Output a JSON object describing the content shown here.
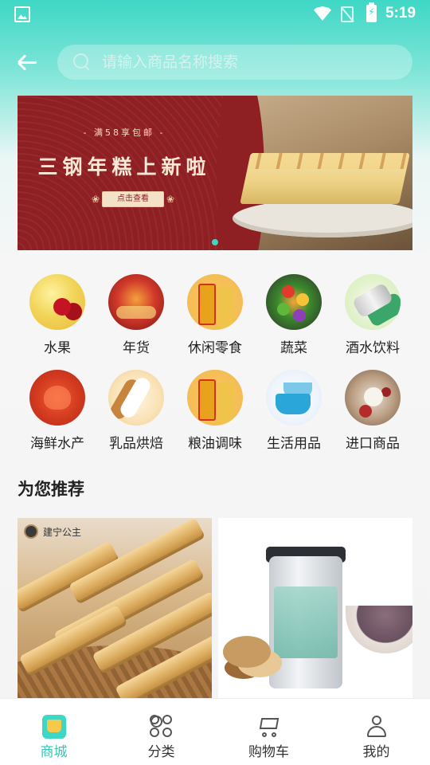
{
  "status_bar": {
    "time": "5:19",
    "icons": [
      "gallery-icon",
      "wifi-icon",
      "no-sim-icon",
      "battery-charging-icon"
    ]
  },
  "header": {
    "back_icon": "arrow-left-icon",
    "search_placeholder": "请输入商品名称搜索",
    "search_icon": "search-icon"
  },
  "banner": {
    "promo": "- 满58享包邮 -",
    "headline": "三钢年糕上新啦",
    "cta": "点击查看",
    "active_dot": 1,
    "accent_color": "#8e1f22"
  },
  "categories": [
    {
      "label": "水果",
      "icon": "fruit-icon"
    },
    {
      "label": "年货",
      "icon": "newyear-goods-icon"
    },
    {
      "label": "休闲零食",
      "icon": "snacks-icon"
    },
    {
      "label": "蔬菜",
      "icon": "vegetables-icon"
    },
    {
      "label": "酒水饮料",
      "icon": "drinks-icon"
    },
    {
      "label": "海鲜水产",
      "icon": "seafood-icon"
    },
    {
      "label": "乳品烘焙",
      "icon": "dairy-bakery-icon"
    },
    {
      "label": "粮油调味",
      "icon": "grain-oil-icon"
    },
    {
      "label": "生活用品",
      "icon": "daily-goods-icon"
    },
    {
      "label": "进口商品",
      "icon": "imported-goods-icon"
    }
  ],
  "recommend": {
    "title": "为您推荐",
    "products": [
      {
        "brand": "建宁公主"
      },
      {
        "brand": ""
      }
    ]
  },
  "tab_bar": {
    "tabs": [
      {
        "label": "商城",
        "icon": "shop-icon",
        "active": true
      },
      {
        "label": "分类",
        "icon": "category-grid-icon",
        "active": false
      },
      {
        "label": "购物车",
        "icon": "cart-icon",
        "active": false
      },
      {
        "label": "我的",
        "icon": "profile-icon",
        "active": false
      }
    ],
    "active_color": "#2fcab7"
  }
}
